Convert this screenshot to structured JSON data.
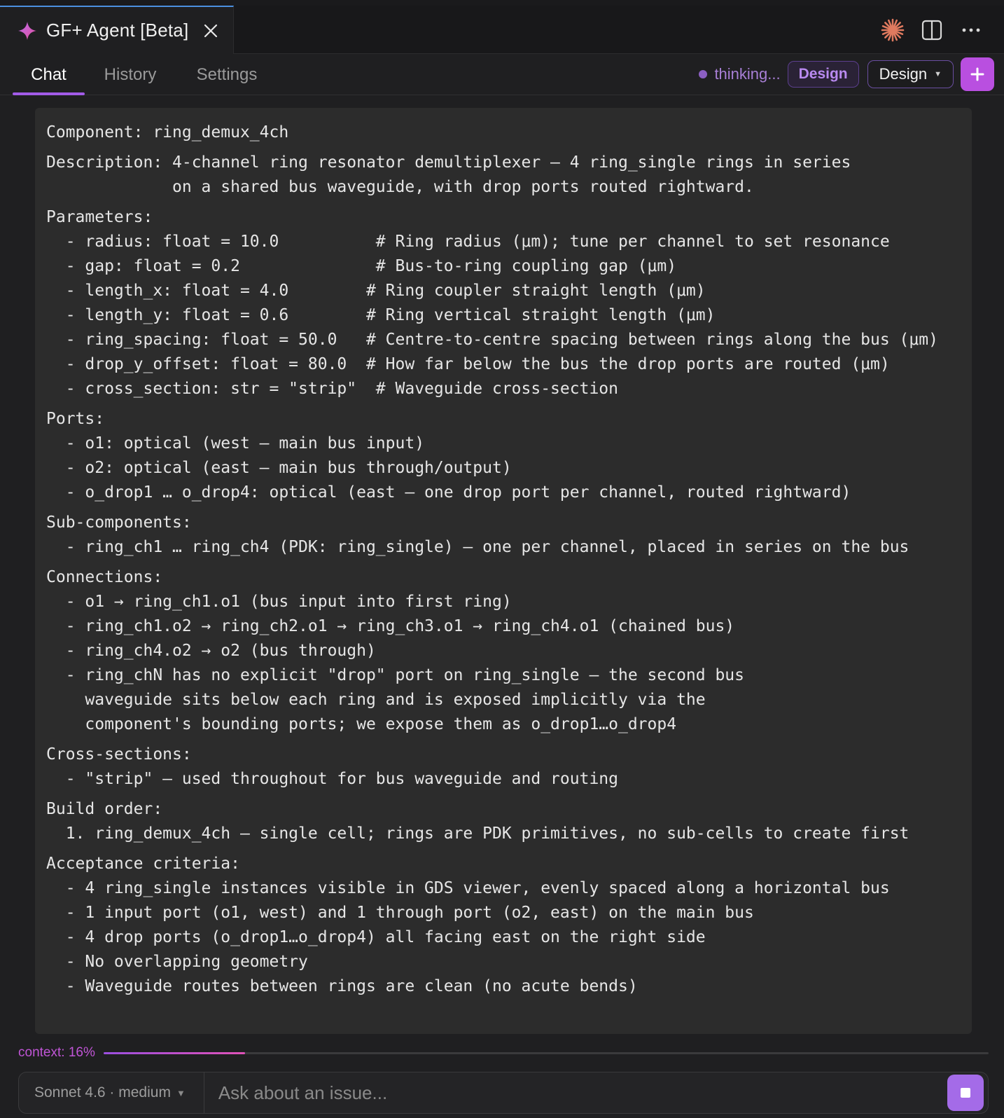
{
  "tab": {
    "title": "GF+ Agent [Beta]",
    "icon": "sparkle-icon",
    "close_icon": "close-icon"
  },
  "top_icons": [
    "claude-starburst-icon",
    "split-panel-icon",
    "more-horizontal-icon"
  ],
  "nav": {
    "tabs": [
      {
        "label": "Chat",
        "active": true
      },
      {
        "label": "History",
        "active": false
      },
      {
        "label": "Settings",
        "active": false
      }
    ],
    "status": "thinking...",
    "mode_badge": "Design",
    "mode_select": "Design",
    "add_icon": "plus-icon"
  },
  "message": {
    "lines": [
      "Component: ring_demux_4ch",
      "Description: 4-channel ring resonator demultiplexer — 4 ring_single rings in series",
      "             on a shared bus waveguide, with drop ports routed rightward.",
      "Parameters:",
      "  - radius: float = 10.0          # Ring radius (μm); tune per channel to set resonance",
      "  - gap: float = 0.2              # Bus-to-ring coupling gap (μm)",
      "  - length_x: float = 4.0        # Ring coupler straight length (μm)",
      "  - length_y: float = 0.6        # Ring vertical straight length (μm)",
      "  - ring_spacing: float = 50.0   # Centre-to-centre spacing between rings along the bus (μm)",
      "  - drop_y_offset: float = 80.0  # How far below the bus the drop ports are routed (μm)",
      "  - cross_section: str = \"strip\"  # Waveguide cross-section",
      "Ports:",
      "  - o1: optical (west — main bus input)",
      "  - o2: optical (east — main bus through/output)",
      "  - o_drop1 … o_drop4: optical (east — one drop port per channel, routed rightward)",
      "Sub-components:",
      "  - ring_ch1 … ring_ch4 (PDK: ring_single) — one per channel, placed in series on the bus",
      "Connections:",
      "  - o1 → ring_ch1.o1 (bus input into first ring)",
      "  - ring_ch1.o2 → ring_ch2.o1 → ring_ch3.o1 → ring_ch4.o1 (chained bus)",
      "  - ring_ch4.o2 → o2 (bus through)",
      "  - ring_chN has no explicit \"drop\" port on ring_single — the second bus",
      "    waveguide sits below each ring and is exposed implicitly via the",
      "    component's bounding ports; we expose them as o_drop1…o_drop4",
      "Cross-sections:",
      "  - \"strip\" — used throughout for bus waveguide and routing",
      "Build order:",
      "  1. ring_demux_4ch — single cell; rings are PDK primitives, no sub-cells to create first",
      "Acceptance criteria:",
      "  - 4 ring_single instances visible in GDS viewer, evenly spaced along a horizontal bus",
      "  - 1 input port (o1, west) and 1 through port (o2, east) on the main bus",
      "  - 4 drop ports (o_drop1…o_drop4) all facing east on the right side",
      "  - No overlapping geometry",
      "  - Waveguide routes between rings are clean (no acute bends)"
    ]
  },
  "context": {
    "label": "context: 16%",
    "percent": 16
  },
  "input": {
    "model": "Sonnet 4.6 · medium",
    "placeholder": "Ask about an issue...",
    "stop_icon": "stop-icon"
  },
  "colors": {
    "accent": "#a25be8",
    "plus_button": "#b94fe0",
    "stop_button": "#a46be8",
    "context_label": "#c055d6",
    "claude_icon": "#e07a5f"
  }
}
